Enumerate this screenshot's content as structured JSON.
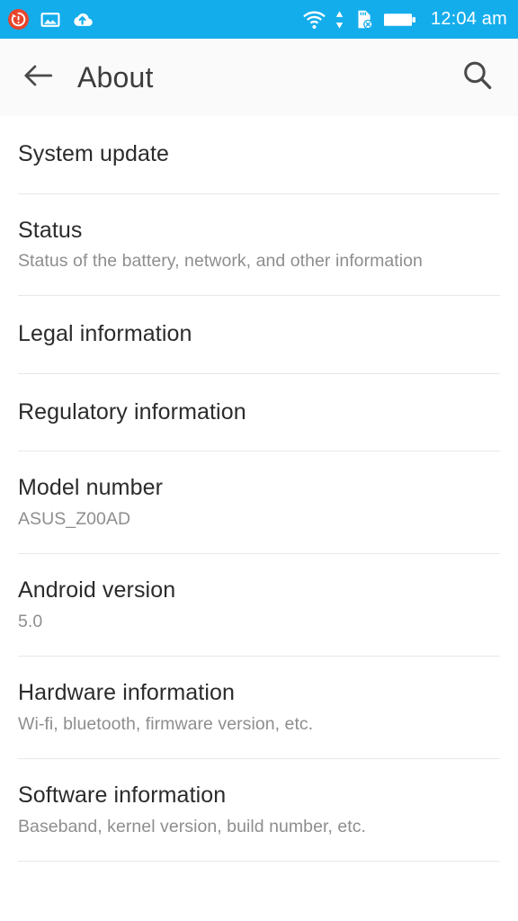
{
  "status_bar": {
    "background_color": "#14ADEC",
    "time": "12:04 am",
    "left_icons": [
      {
        "name": "update-alert-icon",
        "glyph": "update",
        "color": "#E8452C"
      },
      {
        "name": "image-icon",
        "glyph": "photo",
        "color": "#FFFFFF"
      },
      {
        "name": "cloud-upload-icon",
        "glyph": "cloud-upload",
        "color": "#FFFFFF"
      }
    ],
    "right_icons": [
      {
        "name": "wifi-icon",
        "glyph": "wifi",
        "color": "#FFFFFF"
      },
      {
        "name": "data-transfer-arrows-icon",
        "glyph": "up-down-arrows",
        "color": "#FFFFFF"
      },
      {
        "name": "sd-card-missing-icon",
        "glyph": "sd-card-x",
        "color": "#FFFFFF"
      },
      {
        "name": "battery-icon",
        "glyph": "battery-full",
        "color": "#FFFFFF"
      }
    ]
  },
  "action_bar": {
    "back_icon": "arrow-left-icon",
    "title": "About",
    "search_icon": "search-icon",
    "background_color": "#FAFAFA",
    "title_color": "#3C3C3C"
  },
  "list": {
    "divider_color": "#E8E8E8",
    "title_color": "#2B2B2B",
    "subtitle_color": "#8E8E8E",
    "items": [
      {
        "title": "System update",
        "subtitle": ""
      },
      {
        "title": "Status",
        "subtitle": "Status of the battery, network, and other information"
      },
      {
        "title": "Legal information",
        "subtitle": ""
      },
      {
        "title": "Regulatory information",
        "subtitle": ""
      },
      {
        "title": "Model number",
        "subtitle": "ASUS_Z00AD"
      },
      {
        "title": "Android version",
        "subtitle": "5.0"
      },
      {
        "title": "Hardware information",
        "subtitle": "Wi-fi, bluetooth, firmware version, etc."
      },
      {
        "title": "Software information",
        "subtitle": "Baseband, kernel version, build number, etc."
      }
    ]
  }
}
